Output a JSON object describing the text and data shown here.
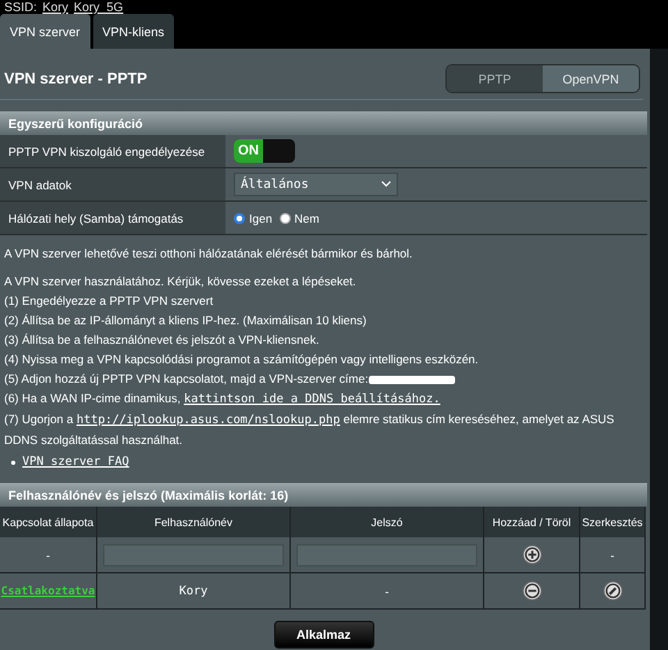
{
  "header": {
    "ssid_label": "SSID:",
    "ssids": [
      "Kory",
      "Kory_5G"
    ]
  },
  "tabs": [
    {
      "label": "VPN szerver",
      "selected": true
    },
    {
      "label": "VPN-kliens",
      "selected": false
    }
  ],
  "title": "VPN szerver - PPTP",
  "mode_switch": [
    {
      "label": "PPTP",
      "selected": true
    },
    {
      "label": "OpenVPN",
      "selected": false
    }
  ],
  "config": {
    "title": "Egyszerű konfiguráció",
    "rows": [
      {
        "kind": "toggle",
        "label": "PPTP VPN kiszolgáló engedélyezése",
        "on": true,
        "on_label": "ON"
      },
      {
        "kind": "select",
        "label": "VPN adatok",
        "value": "Általános"
      },
      {
        "kind": "radio",
        "label": "Hálózati hely (Samba) támogatás",
        "options": [
          {
            "label": "Igen",
            "selected": true
          },
          {
            "label": "Nem",
            "selected": false
          }
        ]
      }
    ]
  },
  "info": {
    "intro": "A VPN szerver lehetővé teszi otthoni hálózatának elérését bármikor és bárhol.",
    "steps_heading": "A VPN szerver használatához. Kérjük, kövesse ezeket a lépéseket.",
    "steps": [
      {
        "text": "(1) Engedélyezze a PPTP VPN szervert"
      },
      {
        "text": "(2) Állítsa be az IP-állományt a kliens IP-hez. (Maximálisan 10 kliens)"
      },
      {
        "text": "(3) Állítsa be a felhasználónevet és jelszót a VPN-kliensnek."
      },
      {
        "text": "(4) Nyissa meg a VPN kapcsolódási programot a számítógépén vagy intelligens eszközén."
      },
      {
        "text": "(5) Adjon hozzá új PPTP VPN kapcsolatot, majd a VPN-szerver címe:",
        "redacted": true
      },
      {
        "text": "(6) Ha a WAN IP-cime dinamikus,",
        "link": "kattintson ide a DDNS beállításához."
      },
      {
        "text": "(7) Ugorjon a",
        "link": "http://iplookup.asus.com/nslookup.php",
        "after": "elemre statikus cím kereséséhez, amelyet az ASUS DDNS szolgáltatással használhat."
      }
    ],
    "faq_link": "VPN szerver FAQ"
  },
  "users": {
    "title": "Felhasználónév és jelszó (Maximális korlát: 16)",
    "columns": [
      "Kapcsolat állapota",
      "Felhasználónév",
      "Jelszó",
      "Hozzáad / Töröl",
      "Szerkesztés"
    ],
    "new_row": {
      "status": "-",
      "edit": "-"
    },
    "rows": [
      {
        "status": "Csatlakoztatva",
        "connected": true,
        "username": "Kory",
        "password": "-"
      }
    ]
  },
  "apply_button": "Alkalmaz"
}
